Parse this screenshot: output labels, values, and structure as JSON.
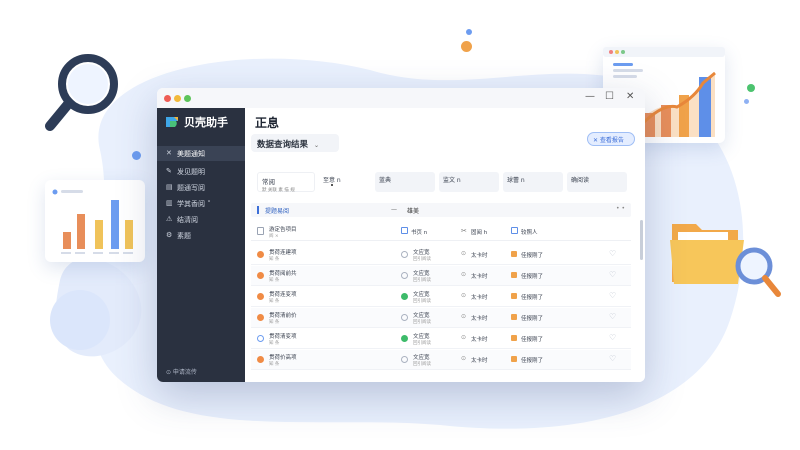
{
  "app": {
    "name": "贝壳助手",
    "page_title": "正息",
    "filter_value": "数据查询结果",
    "action_button": "✕ 查看报告"
  },
  "window_controls": [
    "—",
    "☐",
    "✕"
  ],
  "sidebar": {
    "items": [
      {
        "icon": "✕",
        "label": "美题通知"
      },
      {
        "icon": "✎",
        "label": "发见题明"
      },
      {
        "icon": "▤",
        "label": "题通写阅"
      },
      {
        "icon": "▥",
        "label": "学其香阅 ˅"
      },
      {
        "icon": "⚠",
        "label": "结清阅"
      },
      {
        "icon": "⚙",
        "label": "素题"
      }
    ],
    "footer": "⊙ 申请流传"
  },
  "tabs": [
    {
      "title": "常阅",
      "sub": "默 关联 素 描 规"
    },
    {
      "title": "至意 n",
      "sub": ""
    },
    {
      "title": "蓝典",
      "sub": ""
    },
    {
      "title": "监文 n",
      "sub": ""
    },
    {
      "title": "球蕾 n",
      "sub": ""
    },
    {
      "title": "确阅读",
      "sub": ""
    }
  ],
  "section": {
    "left": "提题易阅",
    "dash": "—",
    "right": "雄美",
    "more": "• •"
  },
  "header_row": {
    "c1_title": "游定告项目",
    "c1_sub": "阅 ×",
    "c2": "书页 n",
    "c3": "固阅 h",
    "c4": "较照人"
  },
  "rows": [
    {
      "title": "贯荷连建项",
      "sub": "知 条",
      "c2a": "文应宽",
      "c2b": "回引阅读",
      "c3": "太卡时",
      "c4": "佳报刚了"
    },
    {
      "title": "贯荷阅前共",
      "sub": "知 条",
      "c2a": "文应宽",
      "c2b": "回引阅读",
      "c3": "太卡时",
      "c4": "佳报刚了"
    },
    {
      "title": "贯荷连变项",
      "sub": "知 条",
      "c2a": "文应宽",
      "c2b": "回引阅读",
      "c3": "太卡时",
      "c4": "佳报刚了"
    },
    {
      "title": "贯荷清前价",
      "sub": "知 条",
      "c2a": "文应宽",
      "c2b": "回引阅读",
      "c3": "太卡时",
      "c4": "佳报刚了"
    },
    {
      "title": "贯荷清变项",
      "sub": "知 条",
      "c2a": "文应宽",
      "c2b": "回引阅读",
      "c3": "太卡时",
      "c4": "佳报刚了"
    },
    {
      "title": "贯荷价高项",
      "sub": "知 条",
      "c2a": "文应宽",
      "c2b": "回引阅读",
      "c3": "太卡时",
      "c4": "佳报刚了"
    }
  ],
  "colors": {
    "sidebar_bg": "#2a3140",
    "accent_blue": "#3d6fd8",
    "accent_orange": "#e8873a",
    "accent_green": "#3dbb6a"
  }
}
